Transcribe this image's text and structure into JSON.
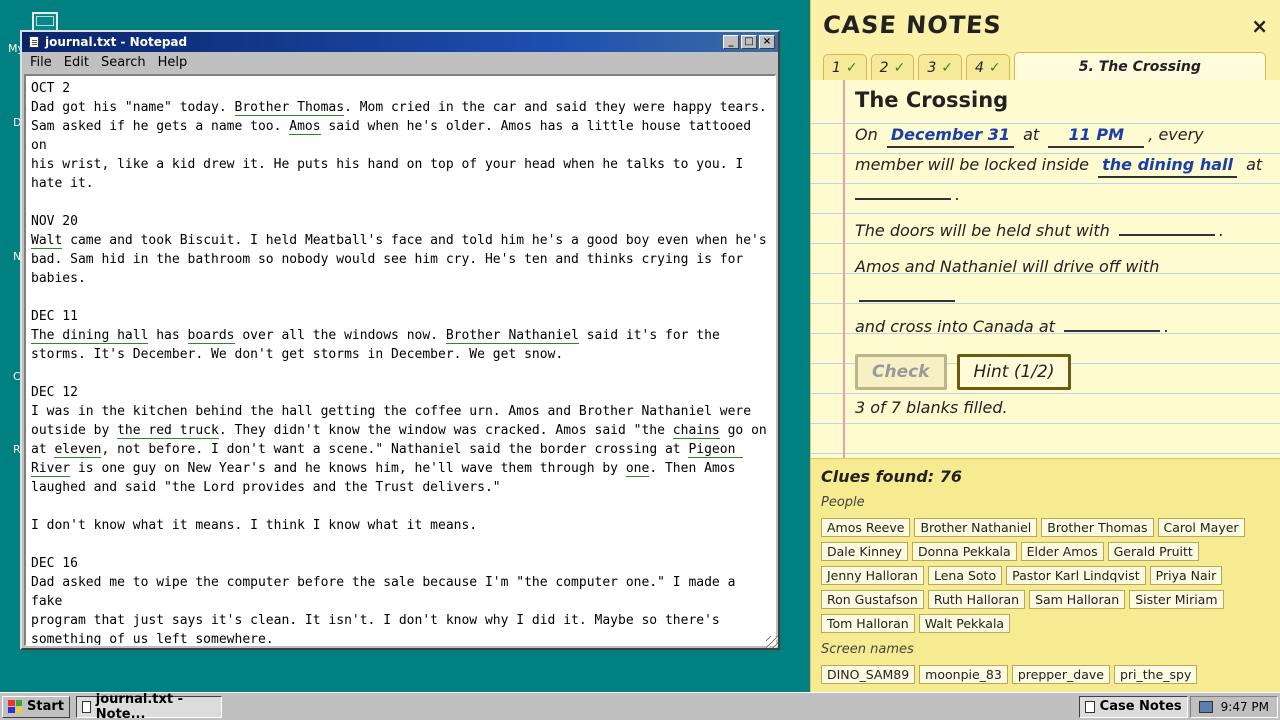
{
  "notepad": {
    "title": "journal.txt - Notepad",
    "menu": [
      "File",
      "Edit",
      "Search",
      "Help"
    ],
    "lines": [
      [
        {
          "t": "OCT 2"
        }
      ],
      [
        {
          "t": "Dad got his \"name\" today. "
        },
        {
          "t": "Brother Thomas",
          "u": true
        },
        {
          "t": ". Mom cried in the car and said they were happy tears."
        }
      ],
      [
        {
          "t": "Sam asked if he gets a name too. "
        },
        {
          "t": "Amos",
          "u": true
        },
        {
          "t": " said when he's older. Amos has a little house tattooed on"
        }
      ],
      [
        {
          "t": "his wrist, like a kid drew it. He puts his hand on top of your head when he talks to you. I"
        }
      ],
      [
        {
          "t": "hate it."
        }
      ],
      [],
      [
        {
          "t": "NOV 20"
        }
      ],
      [
        {
          "t": "Walt",
          "u": true
        },
        {
          "t": " came and took Biscuit. I held Meatball's face and told him he's a good boy even when he's"
        }
      ],
      [
        {
          "t": "bad. Sam hid in the bathroom so nobody would see him cry. He's ten and thinks crying is for"
        }
      ],
      [
        {
          "t": "babies."
        }
      ],
      [],
      [
        {
          "t": "DEC 11"
        }
      ],
      [
        {
          "t": "The dining hall",
          "u": true
        },
        {
          "t": " has "
        },
        {
          "t": "boards",
          "u": true
        },
        {
          "t": " over all the windows now. "
        },
        {
          "t": "Brother Nathaniel",
          "u": true
        },
        {
          "t": " said it's for the"
        }
      ],
      [
        {
          "t": "storms. It's December. We don't get storms in December. We get snow."
        }
      ],
      [],
      [
        {
          "t": "DEC 12"
        }
      ],
      [
        {
          "t": "I was in the kitchen behind the hall getting the coffee urn. Amos and Brother Nathaniel were"
        }
      ],
      [
        {
          "t": "outside by "
        },
        {
          "t": "the red truck",
          "u": true
        },
        {
          "t": ". They didn't know the window was cracked. Amos said \"the "
        },
        {
          "t": "chains",
          "u": true
        },
        {
          "t": " go on"
        }
      ],
      [
        {
          "t": "at "
        },
        {
          "t": "eleven",
          "u": true
        },
        {
          "t": ", not before. I don't want a scene.\" Nathaniel said the border crossing at "
        },
        {
          "t": "Pigeon ",
          "u": true
        }
      ],
      [
        {
          "t": "River",
          "u": true
        },
        {
          "t": " is one guy on New Year's and he knows him, he'll wave them through by "
        },
        {
          "t": "one",
          "u": true
        },
        {
          "t": ". Then Amos"
        }
      ],
      [
        {
          "t": "laughed and said \"the Lord provides and the Trust delivers.\""
        }
      ],
      [],
      [
        {
          "t": "I don't know what it means. I think I know what it means."
        }
      ],
      [],
      [
        {
          "t": "DEC 16"
        }
      ],
      [
        {
          "t": "Dad asked me to wipe the computer before the sale because I'm \"the computer one.\" I made a fake"
        }
      ],
      [
        {
          "t": "program that just says it's clean. It isn't. I don't know why I did it. Maybe so there's"
        }
      ],
      [
        {
          "t": "something of us left somewhere."
        }
      ],
      [],
      [
        {
          "t": "If you're reading this, hi. Please don't be a creep."
        }
      ]
    ]
  },
  "desktop": {
    "letters": [
      "My",
      "D",
      "N",
      "C",
      "R"
    ]
  },
  "case_notes": {
    "title": "CASE NOTES",
    "close": "×",
    "tabs": [
      {
        "label": "1",
        "check": "✓"
      },
      {
        "label": "2",
        "check": "✓"
      },
      {
        "label": "3",
        "check": "✓"
      },
      {
        "label": "4",
        "check": "✓"
      }
    ],
    "active_tab": "5. The Crossing",
    "heading": "The Crossing",
    "s1_a": "On",
    "blank1": "December 31",
    "s1_b": "at",
    "blank2": "11 PM",
    "s1_c": ", every member will be locked inside",
    "blank3": "the dining hall",
    "s1_d": "at",
    "s1_end": ".",
    "s2": "The doors will be held shut with",
    "s2_end": ".",
    "s3": "Amos and Nathaniel will drive off with",
    "s3_b": "and cross into Canada at",
    "s3_end": ".",
    "check_btn": "Check",
    "hint_btn": "Hint (1/2)",
    "filled": "3 of 7 blanks filled."
  },
  "clues": {
    "title": "Clues found: 76",
    "people_label": "People",
    "people": [
      "Amos Reeve",
      "Brother Nathaniel",
      "Brother Thomas",
      "Carol Mayer",
      "Dale Kinney",
      "Donna Pekkala",
      "Elder Amos",
      "Gerald Pruitt",
      "Jenny Halloran",
      "Lena Soto",
      "Pastor Karl Lindqvist",
      "Priya Nair",
      "Ron Gustafson",
      "Ruth Halloran",
      "Sam Halloran",
      "Sister Miriam",
      "Tom Halloran",
      "Walt Pekkala"
    ],
    "screen_label": "Screen names",
    "screen": [
      "DINO_SAM89",
      "moonpie_83",
      "prepper_dave",
      "pri_the_spy"
    ]
  },
  "taskbar": {
    "start": "Start",
    "task": "journal.txt - Note...",
    "tray_app": "Case Notes",
    "time": "9:47 PM"
  },
  "colors": {
    "accent": "#0a246a",
    "desktop": "#008080",
    "notes_bg": "#fbf1a9"
  }
}
